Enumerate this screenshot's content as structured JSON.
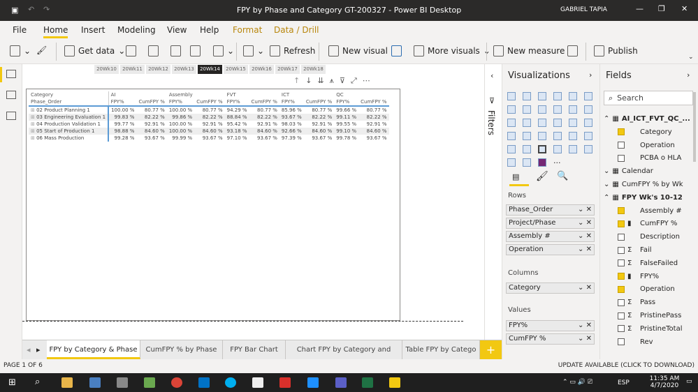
{
  "window": {
    "title": "FPY by Phase and Category GT-200327 - Power BI Desktop",
    "user": "GABRIEL TAPIA"
  },
  "menu": [
    "File",
    "Home",
    "Insert",
    "Modeling",
    "View",
    "Help",
    "Format",
    "Data / Drill"
  ],
  "ribbon": {
    "get_data": "Get data",
    "refresh": "Refresh",
    "new_visual": "New visual",
    "more_visuals": "More visuals",
    "new_measure": "New measure",
    "publish": "Publish"
  },
  "weeks": [
    "20Wk10",
    "20Wk11",
    "20Wk12",
    "20Wk13",
    "20Wk14",
    "20Wk15",
    "20Wk16",
    "20Wk17",
    "20Wk18"
  ],
  "selected_week": "20Wk14",
  "matrix": {
    "row_header_1": "Category",
    "row_header_2": "Phase_Order",
    "categories": [
      "AI",
      "Assembly",
      "FVT",
      "ICT",
      "QC"
    ],
    "measures": [
      "FPY%",
      "CumFPY %"
    ],
    "rows": [
      {
        "label": "02 Product Planning 1",
        "values": [
          "100.00 %",
          "80.77 %",
          "100.00 %",
          "80.77 %",
          "94.29 %",
          "80.77 %",
          "85.96 %",
          "80.77 %",
          "99.66 %",
          "80.77 %"
        ]
      },
      {
        "label": "03 Engineering Evaluation 1",
        "values": [
          "99.83 %",
          "82.22 %",
          "99.86 %",
          "82.22 %",
          "88.84 %",
          "82.22 %",
          "93.67 %",
          "82.22 %",
          "99.11 %",
          "82.22 %"
        ]
      },
      {
        "label": "04 Production Validation 1",
        "values": [
          "99.77 %",
          "92.91 %",
          "100.00 %",
          "92.91 %",
          "95.42 %",
          "92.91 %",
          "98.03 %",
          "92.91 %",
          "99.55 %",
          "92.91 %"
        ]
      },
      {
        "label": "05 Start of Production 1",
        "values": [
          "98.88 %",
          "84.60 %",
          "100.00 %",
          "84.60 %",
          "93.18 %",
          "84.60 %",
          "92.66 %",
          "84.60 %",
          "99.10 %",
          "84.60 %"
        ]
      },
      {
        "label": "06 Mass Production",
        "values": [
          "99.28 %",
          "93.67 %",
          "99.99 %",
          "93.67 %",
          "97.10 %",
          "93.67 %",
          "97.39 %",
          "93.67 %",
          "99.78 %",
          "93.67 %"
        ]
      }
    ]
  },
  "filters_label": "Filters",
  "viz": {
    "title": "Visualizations",
    "rows_label": "Rows",
    "rows": [
      "Phase_Order",
      "Project/Phase",
      "Assembly #",
      "Operation"
    ],
    "columns_label": "Columns",
    "columns": [
      "Category"
    ],
    "values_label": "Values",
    "values": [
      "FPY%",
      "CumFPY %"
    ]
  },
  "fields": {
    "title": "Fields",
    "search_placeholder": "Search",
    "items": [
      {
        "label": "AI_ICT_FVT_QC_...",
        "type": "table",
        "expanded": true
      },
      {
        "label": "Category",
        "checked": true
      },
      {
        "label": "Operation",
        "checked": false
      },
      {
        "label": "PCBA o HLA",
        "checked": false
      },
      {
        "label": "Calendar",
        "type": "table",
        "expanded": false
      },
      {
        "label": "CumFPY % by Wk",
        "type": "table",
        "expanded": false
      },
      {
        "label": "FPY Wk's 10-12",
        "type": "table",
        "expanded": true
      },
      {
        "label": "Assembly #",
        "checked": true
      },
      {
        "label": "CumFPY %",
        "checked": true,
        "icon": "calc"
      },
      {
        "label": "Description",
        "checked": false
      },
      {
        "label": "Fail",
        "checked": false,
        "icon": "sigma"
      },
      {
        "label": "FalseFailed",
        "checked": false,
        "icon": "sigma"
      },
      {
        "label": "FPY%",
        "checked": true,
        "icon": "calc"
      },
      {
        "label": "Operation",
        "checked": true
      },
      {
        "label": "Pass",
        "checked": false,
        "icon": "sigma"
      },
      {
        "label": "PristinePass",
        "checked": false,
        "icon": "sigma"
      },
      {
        "label": "PristineTotal",
        "checked": false,
        "icon": "sigma"
      },
      {
        "label": "Rev",
        "checked": false
      }
    ]
  },
  "tabs": [
    "FPY by Category & Phase",
    "CumFPY % by Phase",
    "FPY Bar Chart",
    "Chart FPY by Category and Phase",
    "Table FPY by Catego"
  ],
  "status": {
    "page": "PAGE 1 OF 6",
    "update": "UPDATE AVAILABLE (CLICK TO DOWNLOAD)"
  },
  "taskbar": {
    "time": "11:35 AM",
    "date": "4/7/2020",
    "lang": "ESP"
  },
  "colors": {
    "accent": "#f2c811",
    "titlebar": "#2b2a29"
  }
}
